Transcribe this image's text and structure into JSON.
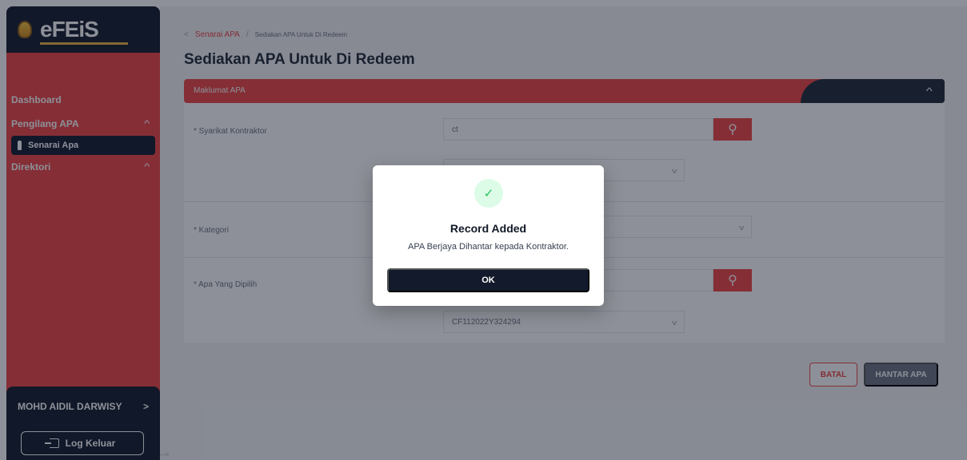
{
  "app": {
    "logo_text": "eFEiS"
  },
  "sidebar": {
    "items": [
      {
        "label": "Dashboard"
      },
      {
        "label": "Pengilang APA"
      },
      {
        "label": "Senarai Apa"
      },
      {
        "label": "Direktori"
      }
    ],
    "user_name": "MOHD AIDIL DARWISY",
    "logout_label": "Log Keluar"
  },
  "breadcrumb": {
    "link": "Senarai APA",
    "separator": "/",
    "current": "Sediakan APA Untuk Di Redeem"
  },
  "page": {
    "title": "Sediakan APA Untuk Di Redeem"
  },
  "panel": {
    "header_label": "Maklumat APA"
  },
  "form": {
    "syarikat_label": "* Syarikat Kontraktor",
    "syarikat_value": "ct",
    "kategori_label": "* Kategori",
    "apa_label": "* Apa Yang Dipilih",
    "apa_select_value": "CF112022Y324294"
  },
  "actions": {
    "batal_label": "BATAL",
    "hantar_label": "HANTAR APA"
  },
  "footer": {
    "arrow": "-->"
  },
  "modal": {
    "icon": "check-icon",
    "title": "Record Added",
    "message": "APA Berjaya Dihantar kepada Kontraktor.",
    "ok_label": "OK"
  },
  "colors": {
    "accent": "#ef4444",
    "dark": "#121a2b",
    "success": "#22c55e"
  }
}
